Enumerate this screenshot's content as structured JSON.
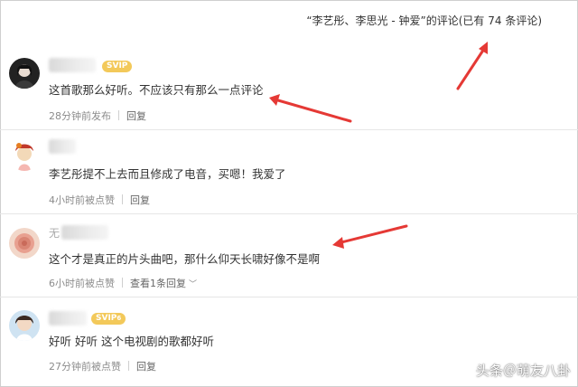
{
  "header": {
    "title": "“李艺彤、李思光 - 钟爱”的评论(已有 74 条评论)"
  },
  "comments": [
    {
      "vip": "SVIP",
      "text": "这首歌那么好听。不应该只有那么一点评论",
      "time": "28分钟前发布",
      "reply": "回复"
    },
    {
      "vip": "",
      "text": "李艺彤提不上去而且修成了电音，买嗯！我爱了",
      "time": "4小时前被点赞",
      "reply": "回复"
    },
    {
      "vip": "",
      "username_visible": "无",
      "text": "这个才是真正的片头曲吧，那什么仰天长啸好像不是啊",
      "time": "6小时前被点赞",
      "reply": "查看1条回复"
    },
    {
      "vip": "SVIP",
      "vip_suffix": "6",
      "text": "好听 好听 这个电视剧的歌都好听",
      "time": "27分钟前被点赞",
      "reply": "回复"
    }
  ],
  "watermark": "头条＠萌友八卦",
  "colors": {
    "arrow": "#e53935",
    "vip": "#f3c95a",
    "meta": "#8c8c8c"
  }
}
